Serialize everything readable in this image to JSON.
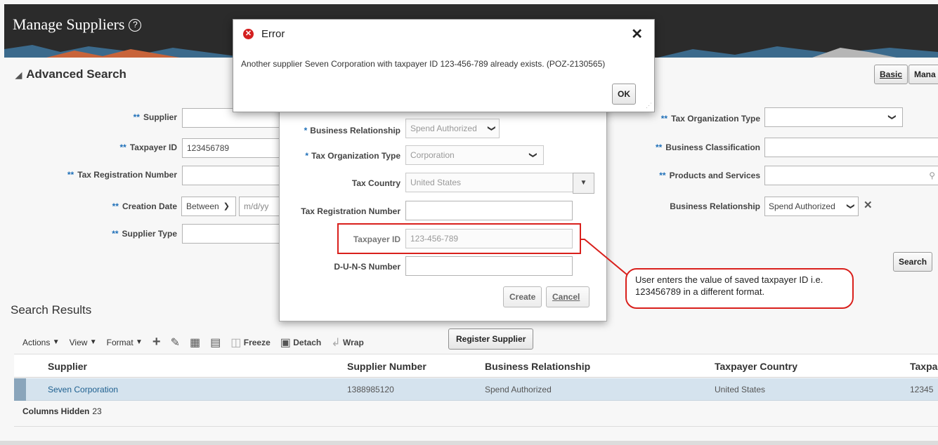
{
  "header": {
    "title": "Manage Suppliers",
    "help_glyph": "?"
  },
  "advanced_search": {
    "title": "Advanced Search",
    "basic_button": "Basic",
    "manage_button": "Mana",
    "search_button": "Search",
    "required_marker": "**",
    "left_fields": {
      "supplier": {
        "label": "Supplier",
        "value": ""
      },
      "taxpayer_id": {
        "label": "Taxpayer ID",
        "value": "123456789"
      },
      "tax_registration_number": {
        "label": "Tax Registration Number",
        "value": ""
      },
      "creation_date": {
        "label": "Creation Date",
        "operator": "Between",
        "placeholder": "m/d/yy"
      },
      "supplier_type": {
        "label": "Supplier Type",
        "value": ""
      }
    },
    "right_fields": {
      "tax_organization_type": {
        "label": "Tax Organization Type",
        "value": ""
      },
      "business_classification": {
        "label": "Business Classification",
        "value": ""
      },
      "products_and_services": {
        "label": "Products and Services",
        "value": ""
      },
      "business_relationship": {
        "label": "Business Relationship",
        "value": "Spend Authorized"
      }
    }
  },
  "create_dialog": {
    "required_marker": "*",
    "business_relationship": {
      "label": "Business Relationship",
      "value": "Spend Authorized"
    },
    "tax_organization_type": {
      "label": "Tax Organization Type",
      "value": "Corporation"
    },
    "tax_country": {
      "label": "Tax Country",
      "value": "United States"
    },
    "tax_registration_number": {
      "label": "Tax Registration Number",
      "value": ""
    },
    "taxpayer_id": {
      "label": "Taxpayer ID",
      "value": "123-456-789"
    },
    "duns_number": {
      "label": "D-U-N-S Number",
      "value": ""
    },
    "create_button": "Create",
    "cancel_button": "Cancel"
  },
  "error_dialog": {
    "title": "Error",
    "message": "Another supplier Seven Corporation with taxpayer ID 123-456-789 already exists. (POZ-2130565)",
    "ok_button": "OK"
  },
  "callout": {
    "text": "User enters the value of saved taxpayer ID i.e. 123456789 in a different format."
  },
  "search_results": {
    "title": "Search Results",
    "toolbar": {
      "actions": "Actions",
      "view": "View",
      "format": "Format",
      "freeze": "Freeze",
      "detach": "Detach",
      "wrap": "Wrap",
      "register_supplier": "Register Supplier"
    },
    "columns": [
      "Supplier",
      "Supplier Number",
      "Business Relationship",
      "Taxpayer Country",
      "Taxpa"
    ],
    "rows": [
      [
        "Seven Corporation",
        "1388985120",
        "Spend Authorized",
        "United States",
        "12345"
      ]
    ],
    "columns_hidden_label": "Columns Hidden",
    "columns_hidden_count": "23"
  }
}
